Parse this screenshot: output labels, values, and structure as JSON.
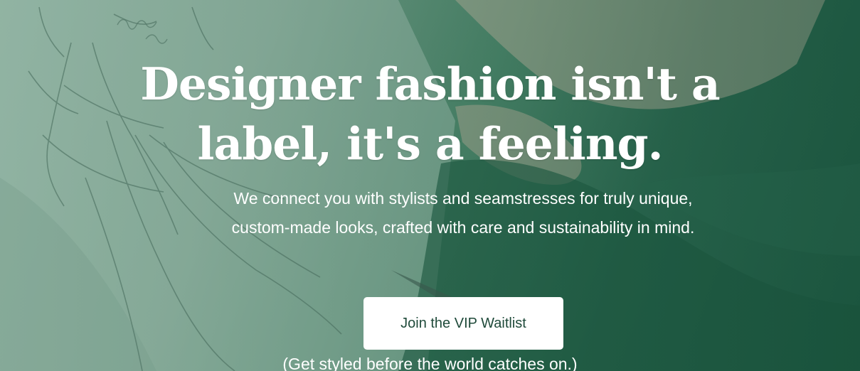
{
  "hero": {
    "headline_line1": "Designer fashion isn't a",
    "headline_line2": "label, it's a feeling.",
    "subtext": "We connect you with stylists and seamstresses for truly unique, custom-made looks, crafted with care and sustainability in mind.",
    "cta_label": "Join the VIP Waitlist",
    "note": "(Get styled before the world catches on.)"
  },
  "colors": {
    "overlay_green": "#2c6b52",
    "cta_background": "#ffffff",
    "cta_text": "#1f4a3a",
    "text": "#ffffff"
  }
}
